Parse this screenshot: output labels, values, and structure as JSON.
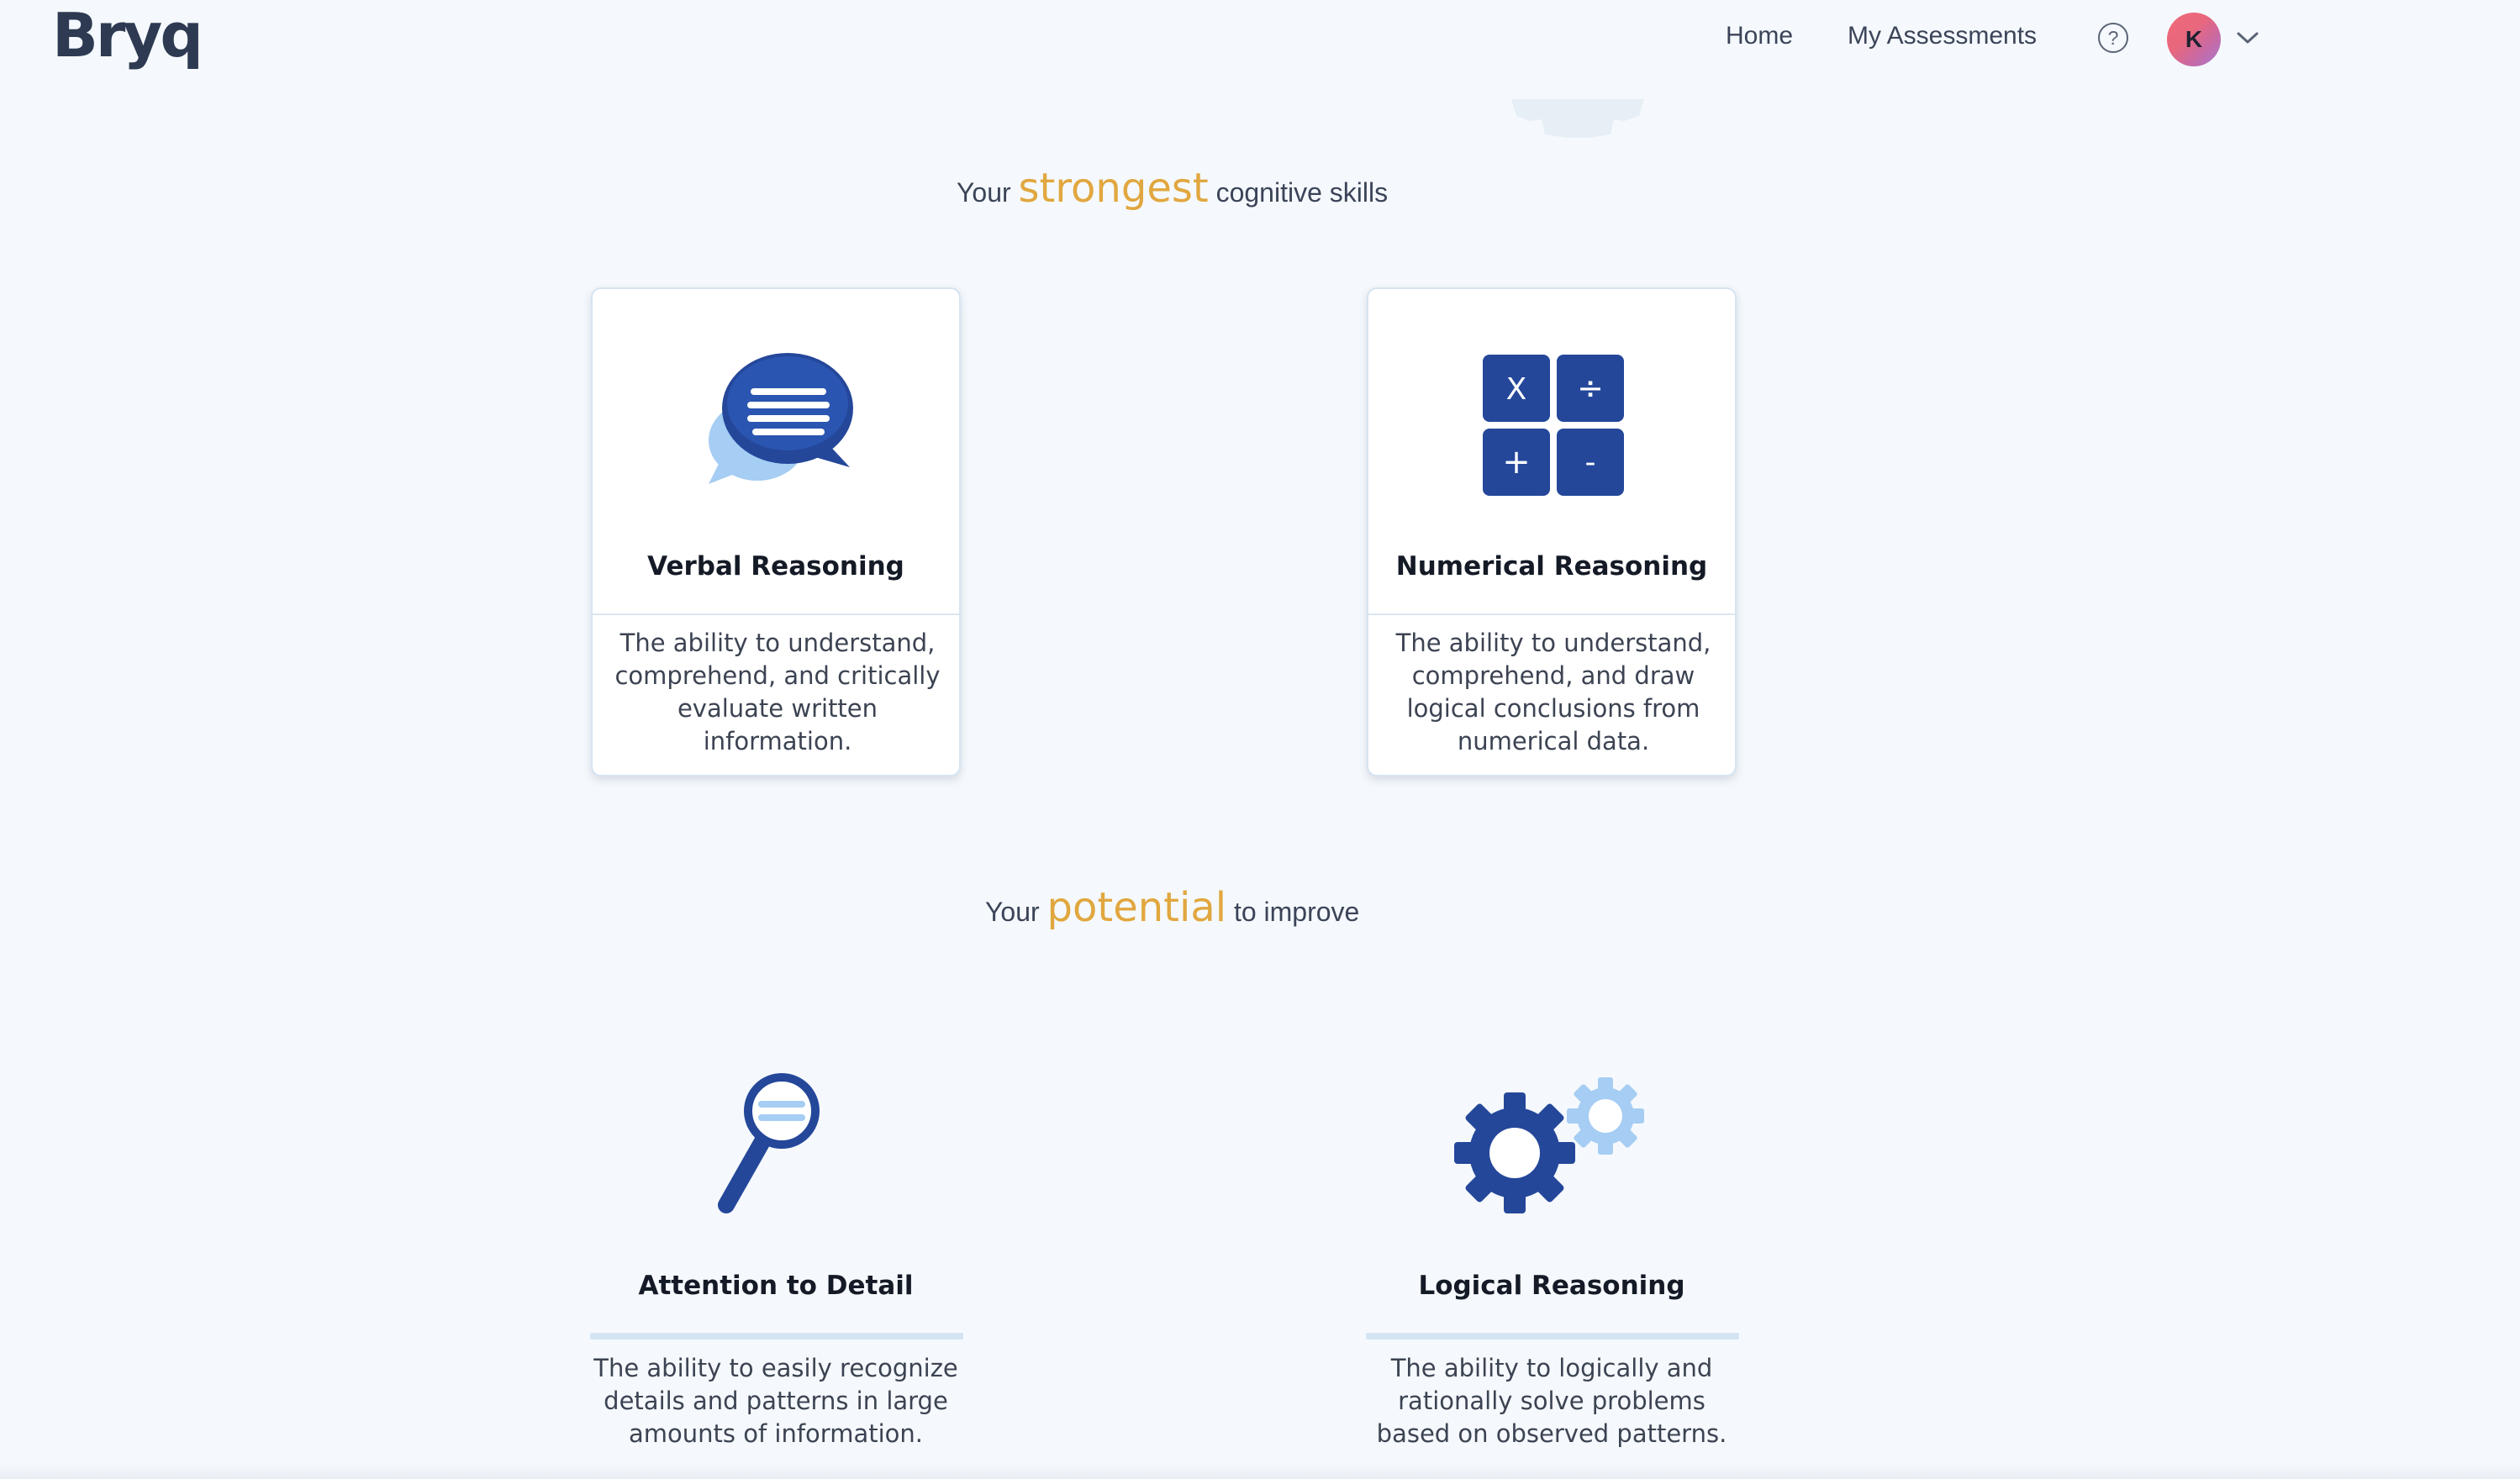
{
  "header": {
    "logo": "Bryq",
    "nav": [
      {
        "label": "Home"
      },
      {
        "label": "My Assessments"
      }
    ],
    "help_glyph": "?",
    "avatar_initial": "K",
    "icons": {
      "help": "help-circle-icon",
      "menu": "chevron-down-icon"
    }
  },
  "strongest": {
    "prefix": "Your",
    "accent": "strongest",
    "suffix": "cognitive skills",
    "cards": [
      {
        "title": "Verbal Reasoning",
        "description": "The ability to understand, comprehend, and critically evaluate written information.",
        "icon": "speech-bubbles-icon"
      },
      {
        "title": "Numerical Reasoning",
        "description": "The ability to understand, comprehend, and draw logical conclusions from numerical data.",
        "icon": "calculator-grid-icon",
        "symbols": [
          "X",
          "÷",
          "+",
          "-"
        ]
      }
    ]
  },
  "potential": {
    "prefix": "Your",
    "accent": "potential",
    "suffix": "to improve",
    "items": [
      {
        "title": "Attention to Detail",
        "description": "The ability to easily recognize details and patterns in large amounts of information.",
        "icon": "magnifying-glass-icon"
      },
      {
        "title": "Logical Reasoning",
        "description": "The ability to logically and rationally solve problems based on observed patterns.",
        "icon": "gears-icon"
      }
    ]
  },
  "colors": {
    "accent": "#e1a73f",
    "icon_primary": "#24479a",
    "icon_light": "#a6cdf3",
    "background": "#f5f9fd"
  }
}
